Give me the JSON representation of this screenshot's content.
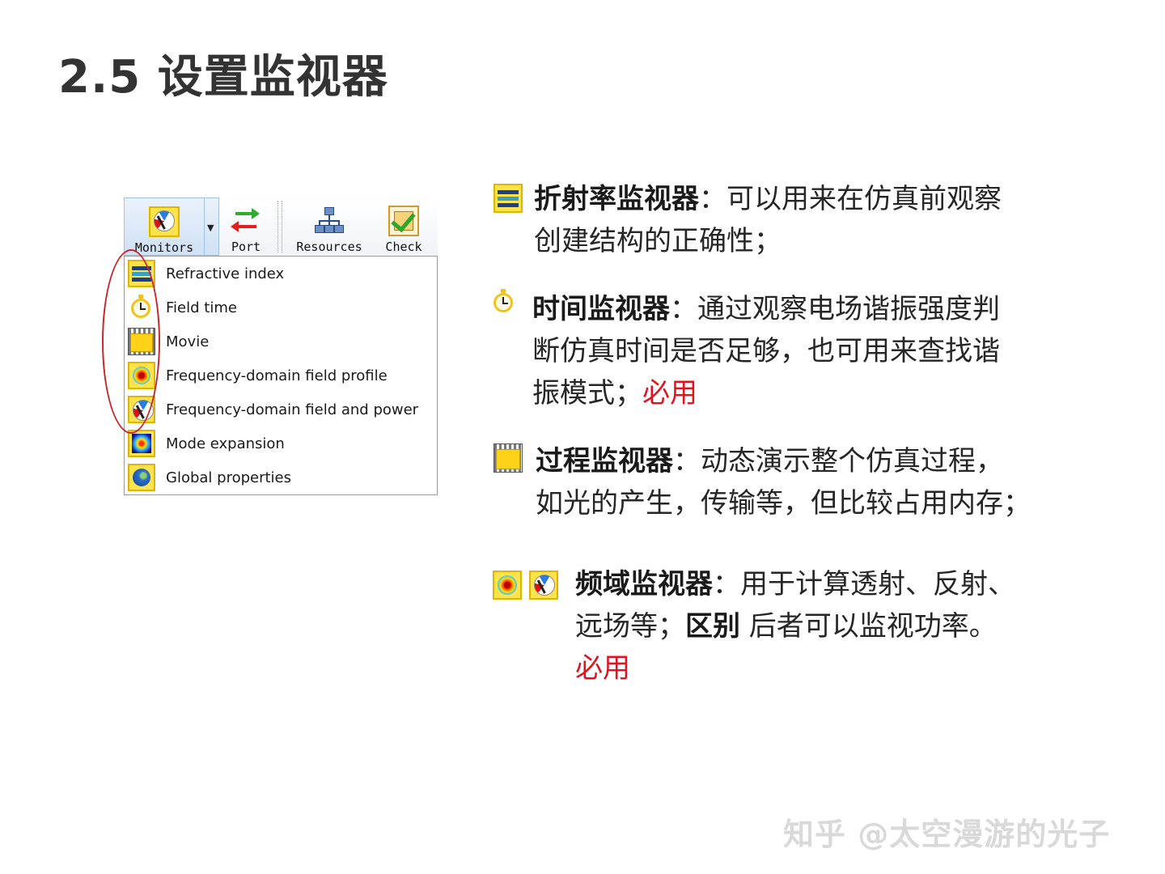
{
  "slide": {
    "title": "2.5 设置监视器"
  },
  "toolbar": {
    "monitors_label": "Monitors",
    "port_label": "Port",
    "resources_label": "Resources",
    "check_label": "Check",
    "icons": {
      "monitors": "monitor-gauge-icon",
      "port": "port-arrows-icon",
      "resources": "resources-tree-icon",
      "check": "check-icon"
    }
  },
  "menu": {
    "items": [
      {
        "label": "Refractive index",
        "icon": "refractive-index-icon"
      },
      {
        "label": "Field time",
        "icon": "field-time-clock-icon"
      },
      {
        "label": "Movie",
        "icon": "movie-film-icon"
      },
      {
        "label": "Frequency-domain field profile",
        "icon": "frequency-profile-icon"
      },
      {
        "label": "Frequency-domain field and power",
        "icon": "frequency-power-gauge-icon"
      },
      {
        "label": "Mode expansion",
        "icon": "mode-expansion-icon"
      },
      {
        "label": "Global properties",
        "icon": "global-properties-globe-icon"
      }
    ],
    "highlight_color": "#c8262b"
  },
  "notes": {
    "refractive": {
      "title": "折射率监视器",
      "line1": "：可以用来在仿真前观察",
      "line2": "创建结构的正确性；"
    },
    "time": {
      "title": "时间监视器",
      "line1": "：通过观察电场谐振强度判",
      "line2": "断仿真时间是否足够，也可用来查找谐",
      "line3": "振模式；",
      "tag": "必用"
    },
    "movie": {
      "title": "过程监视器",
      "line1": "：动态演示整个仿真过程，",
      "line2": "如光的产生，传输等，但比较占用内存；"
    },
    "frequency": {
      "title": "频域监视器",
      "line1": "：用于计算透射、反射、",
      "line2a": "远场等；",
      "line2b": "区别",
      "line2c": " 后者可以监视功率。",
      "tag": "必用"
    }
  },
  "watermark": "知乎 @太空漫游的光子",
  "colors": {
    "accent_red": "#e0141e",
    "title_gray": "#333333",
    "icon_yellow": "#ffe34a"
  }
}
